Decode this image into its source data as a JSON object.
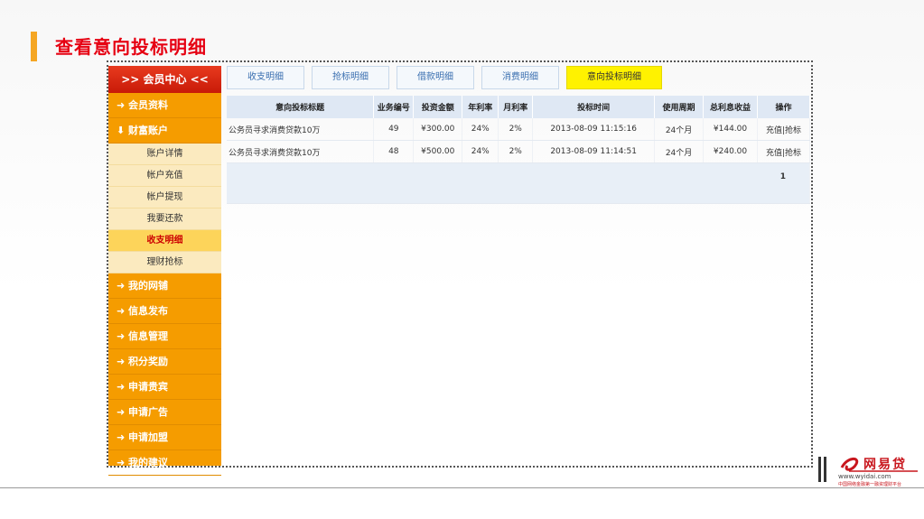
{
  "page": {
    "title": "查看意向投标明细"
  },
  "sidebar": {
    "header": ">> 会员中心 <<",
    "items_top": [
      {
        "label": "会员资料"
      },
      {
        "label": "财富账户"
      }
    ],
    "sub_items": [
      {
        "label": "账户详情"
      },
      {
        "label": "帐户充值"
      },
      {
        "label": "帐户提现"
      },
      {
        "label": "我要还款"
      },
      {
        "label": "收支明细"
      },
      {
        "label": "理财抢标"
      }
    ],
    "items_bottom": [
      {
        "label": "我的网铺"
      },
      {
        "label": "信息发布"
      },
      {
        "label": "信息管理"
      },
      {
        "label": "积分奖励"
      },
      {
        "label": "申请贵宾"
      },
      {
        "label": "申请广告"
      },
      {
        "label": "申请加盟"
      },
      {
        "label": "我的建议"
      }
    ]
  },
  "tabs": [
    {
      "label": "收支明细"
    },
    {
      "label": "抢标明细"
    },
    {
      "label": "借款明细"
    },
    {
      "label": "消费明细"
    },
    {
      "label": "意向投标明细"
    }
  ],
  "table": {
    "columns": [
      "意向投标标题",
      "业务编号",
      "投资金额",
      "年利率",
      "月利率",
      "投标时间",
      "使用周期",
      "总利息收益",
      "操作"
    ],
    "rows": [
      [
        "公务员寻求消费贷款10万",
        "49",
        "¥300.00",
        "24%",
        "2%",
        "2013-08-09 11:15:16",
        "24个月",
        "¥144.00",
        "充值|抢标"
      ],
      [
        "公务员寻求消费贷款10万",
        "48",
        "¥500.00",
        "24%",
        "2%",
        "2013-08-09 11:14:51",
        "24个月",
        "¥240.00",
        "充值|抢标"
      ]
    ],
    "page_number": "1"
  },
  "logo": {
    "name": "网易贷",
    "url": "www.wyidai.com",
    "slogan": "中国网络金融第一融资理财平台"
  },
  "colors": {
    "accent_red": "#e60012",
    "sidebar_orange": "#f59c00",
    "active_tab": "#fff200"
  }
}
